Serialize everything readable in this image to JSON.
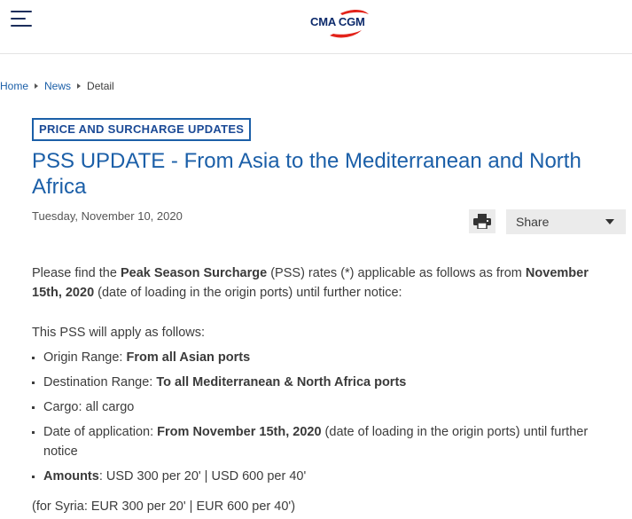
{
  "header": {
    "logo_text": "CMA CGM",
    "menu_icon": "hamburger-menu-icon"
  },
  "breadcrumb": {
    "home": "Home",
    "news": "News",
    "current": "Detail"
  },
  "article": {
    "category": "PRICE AND SURCHARGE UPDATES",
    "title": "PSS UPDATE - From Asia to the Mediterranean and North Africa",
    "date": "Tuesday, November 10, 2020",
    "actions": {
      "print_icon": "printer-icon",
      "share_label": "Share"
    },
    "intro": {
      "t1": "Please find the ",
      "b1": "Peak Season Surcharge",
      "t2": " (PSS) rates (*) applicable as follows as from ",
      "b2": "November 15th, 2020",
      "t3": " (date of loading in the origin ports) until further notice:"
    },
    "apply_intro": "This PSS will apply as follows:",
    "bullets": [
      {
        "label": "Origin Range: ",
        "value": "From all Asian ports",
        "rest": ""
      },
      {
        "label": "Destination Range: ",
        "value": "To all Mediterranean & North Africa ports",
        "rest": ""
      },
      {
        "label": "Cargo: all cargo",
        "value": "",
        "rest": ""
      },
      {
        "label": "Date of application: ",
        "value": "From November 15th, 2020",
        "rest": " (date of loading in the origin ports) until further notice"
      },
      {
        "label": "",
        "value": "Amounts",
        "rest": ": USD 300 per 20' | USD 600 per 40'"
      }
    ],
    "syria_note": "(for Syria: EUR 300 per 20' | EUR 600 per 40')"
  },
  "colors": {
    "brand_blue": "#1b5fa8",
    "navy": "#0c2a6b",
    "logo_red": "#e2231a",
    "button_bg": "#ebebeb"
  }
}
